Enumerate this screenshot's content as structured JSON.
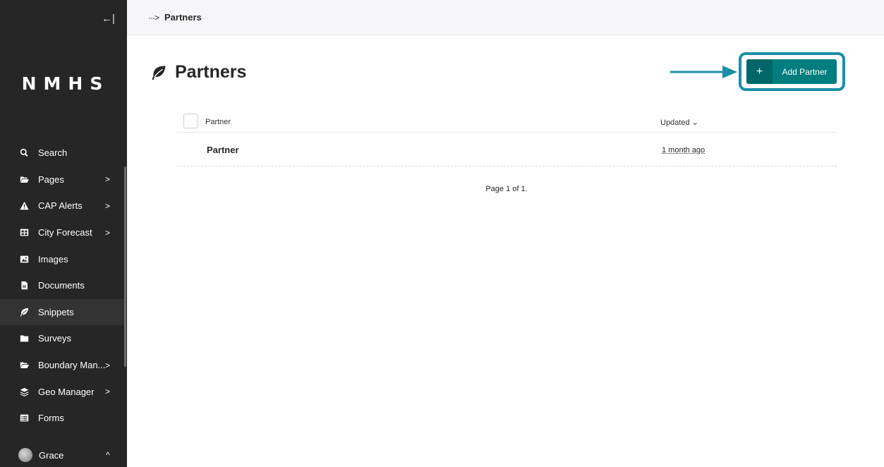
{
  "sidebar": {
    "collapse_icon": "arrow-left-bar-icon",
    "logo": "NMHS",
    "items": [
      {
        "label": "Search",
        "icon": "search-icon",
        "chevron": ""
      },
      {
        "label": "Pages",
        "icon": "folder-open-icon",
        "chevron": ">"
      },
      {
        "label": "CAP Alerts",
        "icon": "warning-icon",
        "chevron": ">"
      },
      {
        "label": "City Forecast",
        "icon": "table-icon",
        "chevron": ">"
      },
      {
        "label": "Images",
        "icon": "image-icon",
        "chevron": ""
      },
      {
        "label": "Documents",
        "icon": "document-icon",
        "chevron": ""
      },
      {
        "label": "Snippets",
        "icon": "leaf-icon",
        "chevron": ""
      },
      {
        "label": "Surveys",
        "icon": "folder-icon",
        "chevron": ""
      },
      {
        "label": "Boundary Man...",
        "icon": "folder-open-icon",
        "chevron": ">"
      },
      {
        "label": "Geo Manager",
        "icon": "layers-icon",
        "chevron": ">"
      },
      {
        "label": "Forms",
        "icon": "list-icon",
        "chevron": ""
      }
    ],
    "user": {
      "name": "Grace",
      "chevron": "^"
    }
  },
  "header": {
    "breadcrumb_more": "···>",
    "breadcrumb_current": "Partners"
  },
  "page": {
    "title": "Partners",
    "add_button_plus": "+",
    "add_button_label": "Add Partner"
  },
  "table": {
    "columns": {
      "title": "Partner",
      "updated": "Updated ⌄"
    },
    "rows": [
      {
        "title": "Partner",
        "updated": "1 month ago"
      }
    ]
  },
  "pagination": "Page 1 of 1.",
  "colors": {
    "accent": "#007d7e",
    "highlight": "#1b8fa6",
    "sidebar": "#262626"
  }
}
